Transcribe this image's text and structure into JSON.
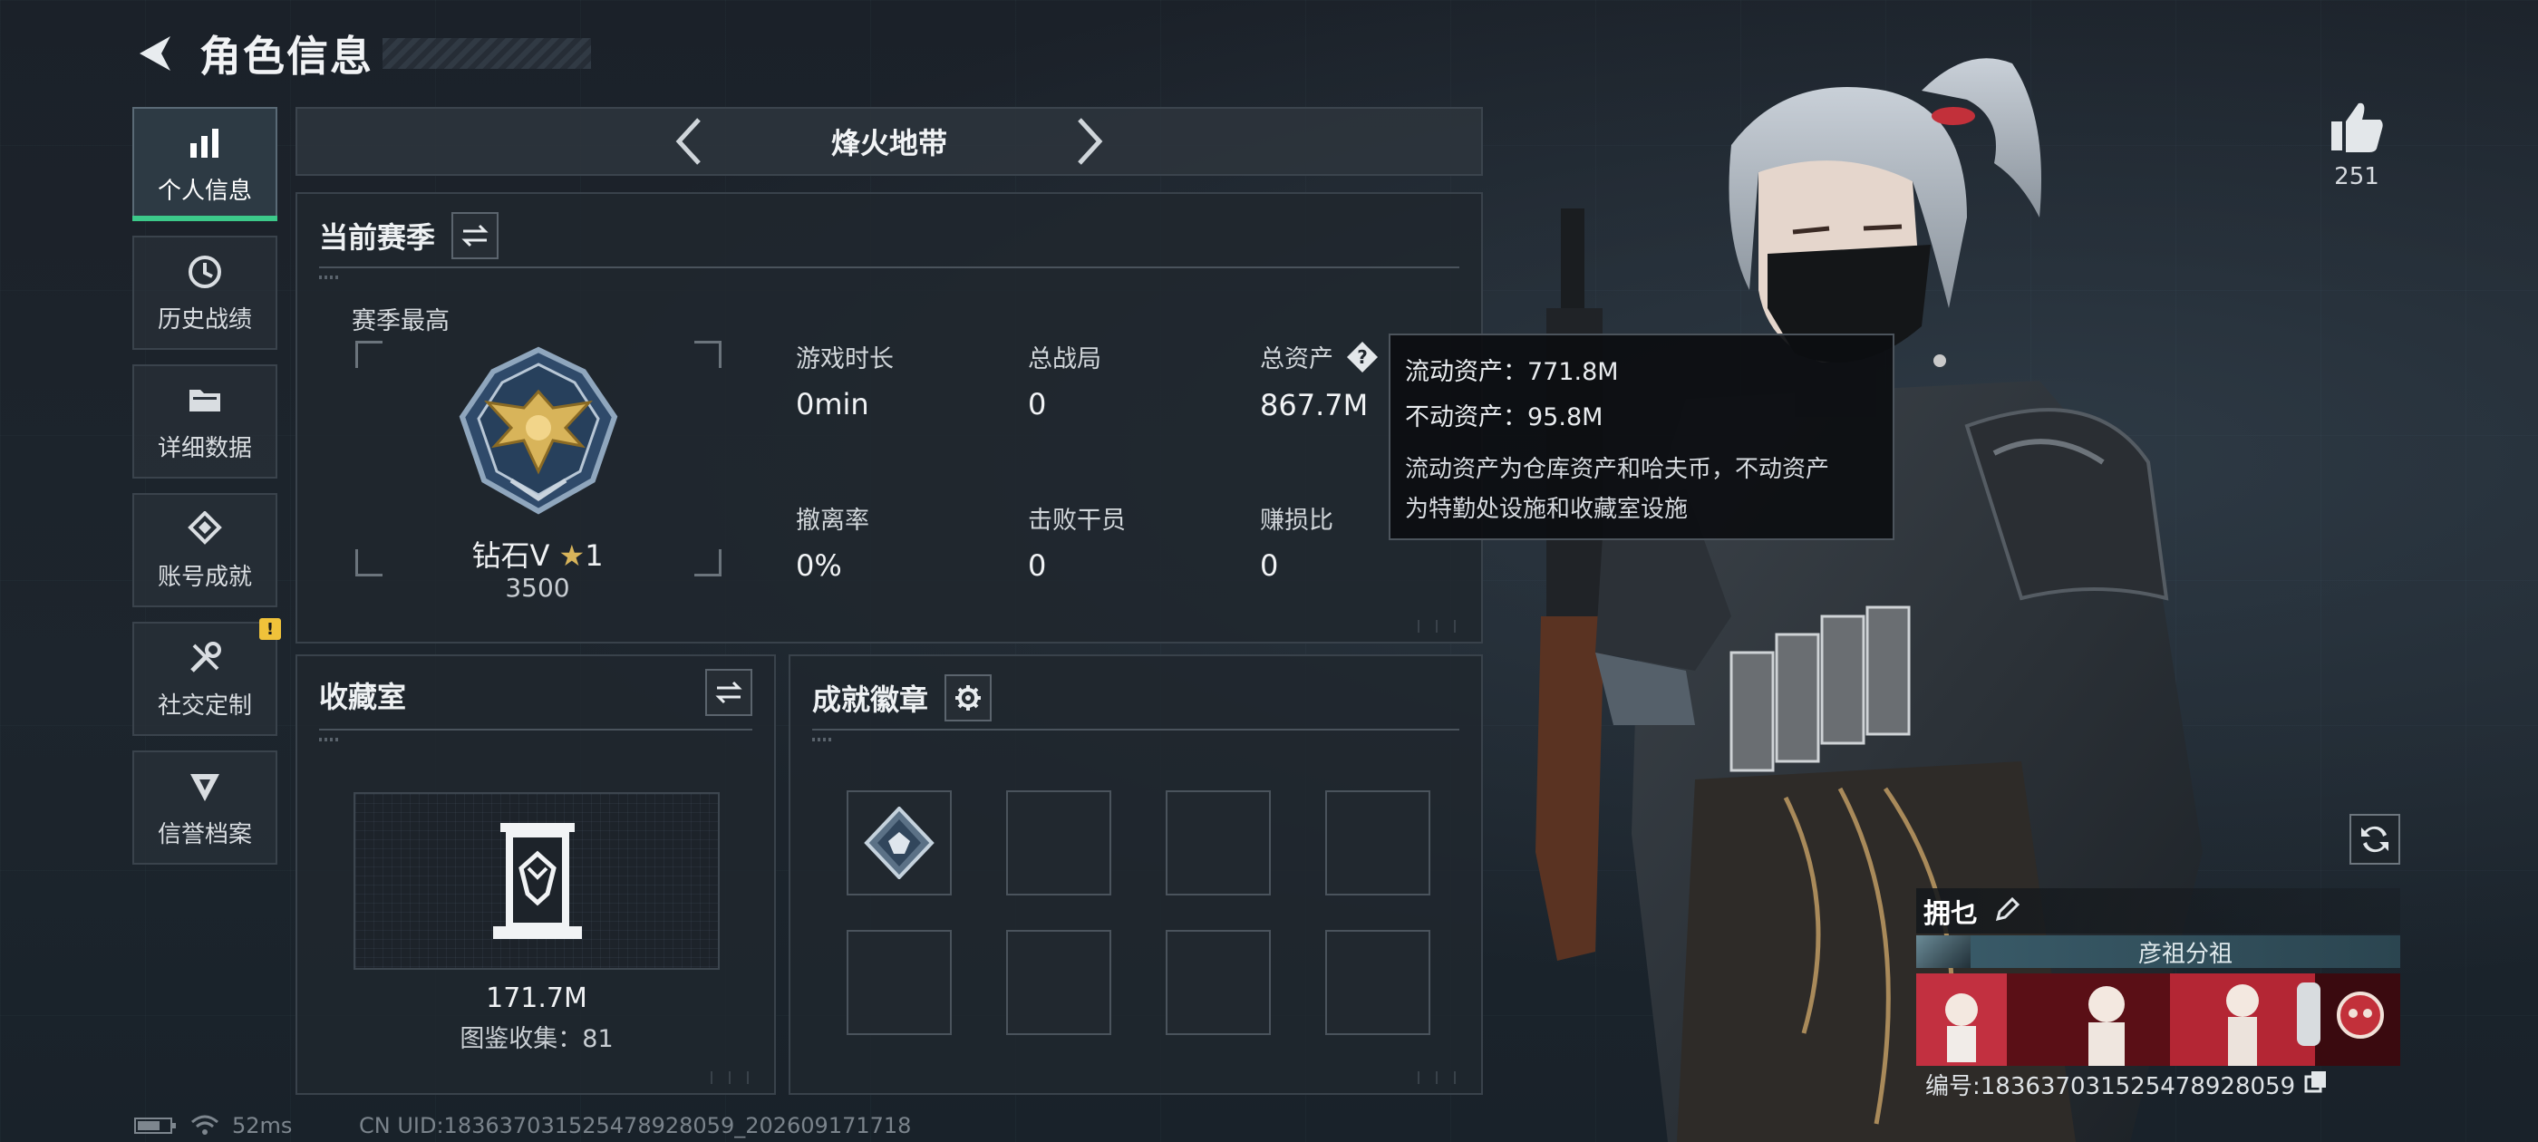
{
  "header": {
    "title": "角色信息"
  },
  "nav": {
    "items": [
      {
        "label": "个人信息",
        "icon": "bar-chart-icon",
        "active": true
      },
      {
        "label": "历史战绩",
        "icon": "history-clock-icon"
      },
      {
        "label": "详细数据",
        "icon": "folder-icon"
      },
      {
        "label": "账号成就",
        "icon": "achievement-diamond-icon"
      },
      {
        "label": "社交定制",
        "icon": "tools-icon",
        "badge": "!"
      },
      {
        "label": "信誉档案",
        "icon": "shield-rank-icon"
      }
    ]
  },
  "mode": {
    "title": "烽火地带"
  },
  "season": {
    "title": "当前赛季",
    "best_label": "赛季最高",
    "rank_name": "钻石V",
    "rank_stars": "1",
    "rank_score": "3500",
    "stats": [
      {
        "label": "游戏时长",
        "value": "0min"
      },
      {
        "label": "总战局",
        "value": "0"
      },
      {
        "label": "总资产",
        "value": "867.7M"
      },
      {
        "label": "撤离率",
        "value": "0%"
      },
      {
        "label": "击败干员",
        "value": "0"
      },
      {
        "label": "赚损比",
        "value": "0"
      }
    ]
  },
  "tooltip": {
    "liquid": "流动资产：771.8M",
    "fixed": "不动资产：95.8M",
    "desc_line1": "流动资产为仓库资产和哈夫币，不动资产",
    "desc_line2": "为特勤处设施和收藏室设施"
  },
  "collection": {
    "title": "收藏室",
    "value": "171.7M",
    "count": "图鉴收集：81"
  },
  "badges": {
    "title": "成就徽章",
    "slots": 8
  },
  "likes": {
    "count": "251"
  },
  "player": {
    "name": "拥乜",
    "clan": "彦祖分祖",
    "id": "编号:1836370315254789280​59"
  },
  "status": {
    "ping": "52ms",
    "uid": "CN UID:183637031525478928059_202609171718"
  },
  "colors": {
    "accent": "#3cc98a",
    "warn": "#f0c23a",
    "gold": "#d8b45a"
  }
}
